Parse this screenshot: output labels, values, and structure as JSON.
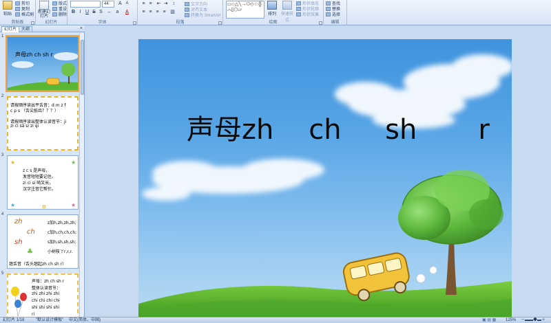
{
  "ribbon": {
    "clipboard": {
      "label": "剪贴板",
      "paste": "粘贴",
      "cut": "剪切",
      "copy": "复制",
      "format_painter": "格式刷"
    },
    "slides": {
      "label": "幻灯片",
      "new_slide": "新建幻灯片",
      "layout": "版式",
      "reset": "重设",
      "delete": "删除"
    },
    "font": {
      "label": "字体",
      "size": "44"
    },
    "paragraph": {
      "label": "段落",
      "text_direction": "文字方向",
      "align_text": "对齐文本",
      "smartart": "转换为 SmartArt"
    },
    "drawing": {
      "label": "绘图",
      "arrange": "排列",
      "quick_styles": "快速样式",
      "shape_fill": "形状填充",
      "shape_outline": "形状轮廓",
      "shape_effects": "形状效果"
    },
    "editing": {
      "label": "编辑",
      "find": "查找",
      "replace": "替换",
      "select": "选择"
    }
  },
  "left_pane": {
    "tabs": [
      "幻灯片",
      "大纲"
    ],
    "close": "×",
    "slides": [
      {
        "number": "1",
        "title": "声母zh  ch  sh  r"
      },
      {
        "number": "2",
        "lines": [
          "请按顺序读出平舌音：d m z f",
          "c p s （舌尖抵齿？？？）",
          "请按顺序读出整体认读音节：ji",
          "zi ci  sā  si   zi qi"
        ]
      },
      {
        "number": "3",
        "lines": [
          "z  c  s 是声母，",
          "发音短短要记住。",
          "zi  ci  si  响又长，",
          "汉字注音它帮忙。"
        ]
      },
      {
        "number": "4",
        "letters": [
          "zh",
          "ch",
          "sh",
          "r"
        ],
        "lines": [
          "z加h,zh,zh,zh;",
          "c加h,ch,ch,ch;",
          "s加h,sh,sh,sh;",
          "小树枝丫r,r,r."
        ],
        "footer": "翘舌音（舌头翘起zh  ch  sh  r）"
      },
      {
        "number": "5",
        "lines": [
          "声母：zh  ch  sh   r",
          "整体认读音节：",
          "zhi   zhi   zhi   zhi",
          "chi   chi   chi   chi",
          "shi   shi   shi   shi",
          "ri"
        ]
      }
    ]
  },
  "slide": {
    "title": "声母zh    ch     sh       r"
  },
  "status_bar": {
    "slide_info": "幻灯片 1/18",
    "theme": "\"默认设计模板\"",
    "language": "中文(简体，中国)",
    "zoom": "125%"
  }
}
